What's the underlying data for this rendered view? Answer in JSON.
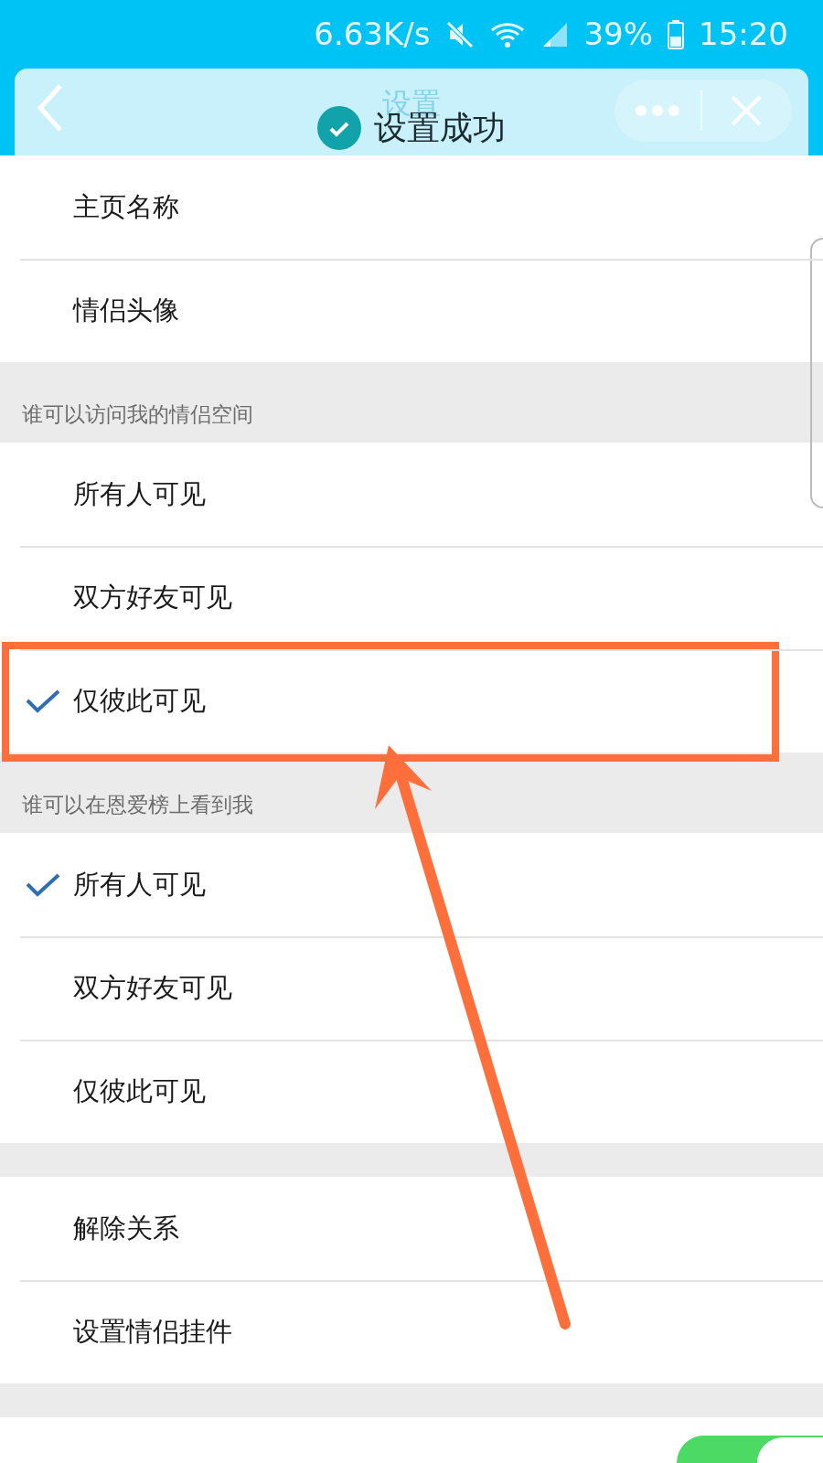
{
  "status_bar": {
    "speed": "6.63K/s",
    "battery": "39%",
    "time": "15:20"
  },
  "header": {
    "title": "设置"
  },
  "toast": {
    "text": "设置成功"
  },
  "sections": [
    {
      "items": [
        {
          "label": "主页名称"
        },
        {
          "label": "情侣头像"
        }
      ]
    },
    {
      "heading": "谁可以访问我的情侣空间",
      "items": [
        {
          "label": "所有人可见",
          "selected": false
        },
        {
          "label": "双方好友可见",
          "selected": false
        },
        {
          "label": "仅彼此可见",
          "selected": true,
          "highlighted": true
        }
      ]
    },
    {
      "heading": "谁可以在恩爱榜上看到我",
      "items": [
        {
          "label": "所有人可见",
          "selected": true
        },
        {
          "label": "双方好友可见",
          "selected": false
        },
        {
          "label": "仅彼此可见",
          "selected": false
        }
      ]
    },
    {
      "items": [
        {
          "label": "解除关系"
        },
        {
          "label": "设置情侣挂件"
        }
      ]
    }
  ],
  "bottom_toggle": {
    "on": true
  }
}
